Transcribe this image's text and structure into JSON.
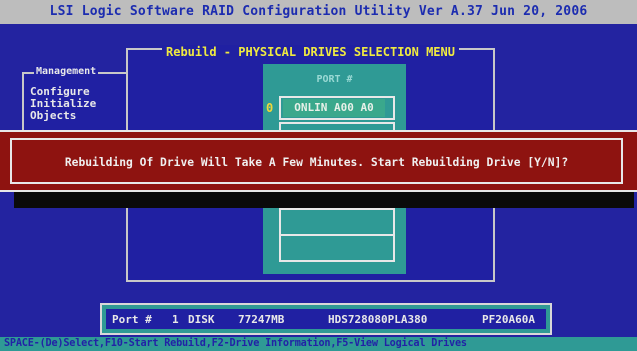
{
  "title_bar": {
    "title": "LSI Logic Software RAID Configuration Utility Ver A.37 Jun 20, 2006"
  },
  "management_menu": {
    "title": "Management",
    "items": [
      "Configure",
      "Initialize",
      "Objects"
    ]
  },
  "rebuild_menu": {
    "title": "Rebuild - PHYSICAL DRIVES SELECTION MENU",
    "port_header": "PORT #",
    "drives": [
      {
        "index": "0",
        "state": "ONLIN A00 A0"
      }
    ]
  },
  "dialog": {
    "message": "Rebuilding Of Drive Will Take A Few Minutes. Start Rebuilding Drive [Y/N]?"
  },
  "port_info": {
    "port_label": "Port #",
    "port_number": "1",
    "type": "DISK",
    "size": "77247MB",
    "model": "HDS728080PLA380",
    "firmware": "PF20A60A"
  },
  "footer": {
    "text": "SPACE-(De)Select,F10-Start Rebuild,F2-Drive Information,F5-View Logical Drives"
  },
  "colors": {
    "background": "#2323a0",
    "title_bar": "#bdbdbd",
    "dialog": "#8e1310",
    "teal": "#2f9a95",
    "highlight_text": "#f0ea40"
  }
}
